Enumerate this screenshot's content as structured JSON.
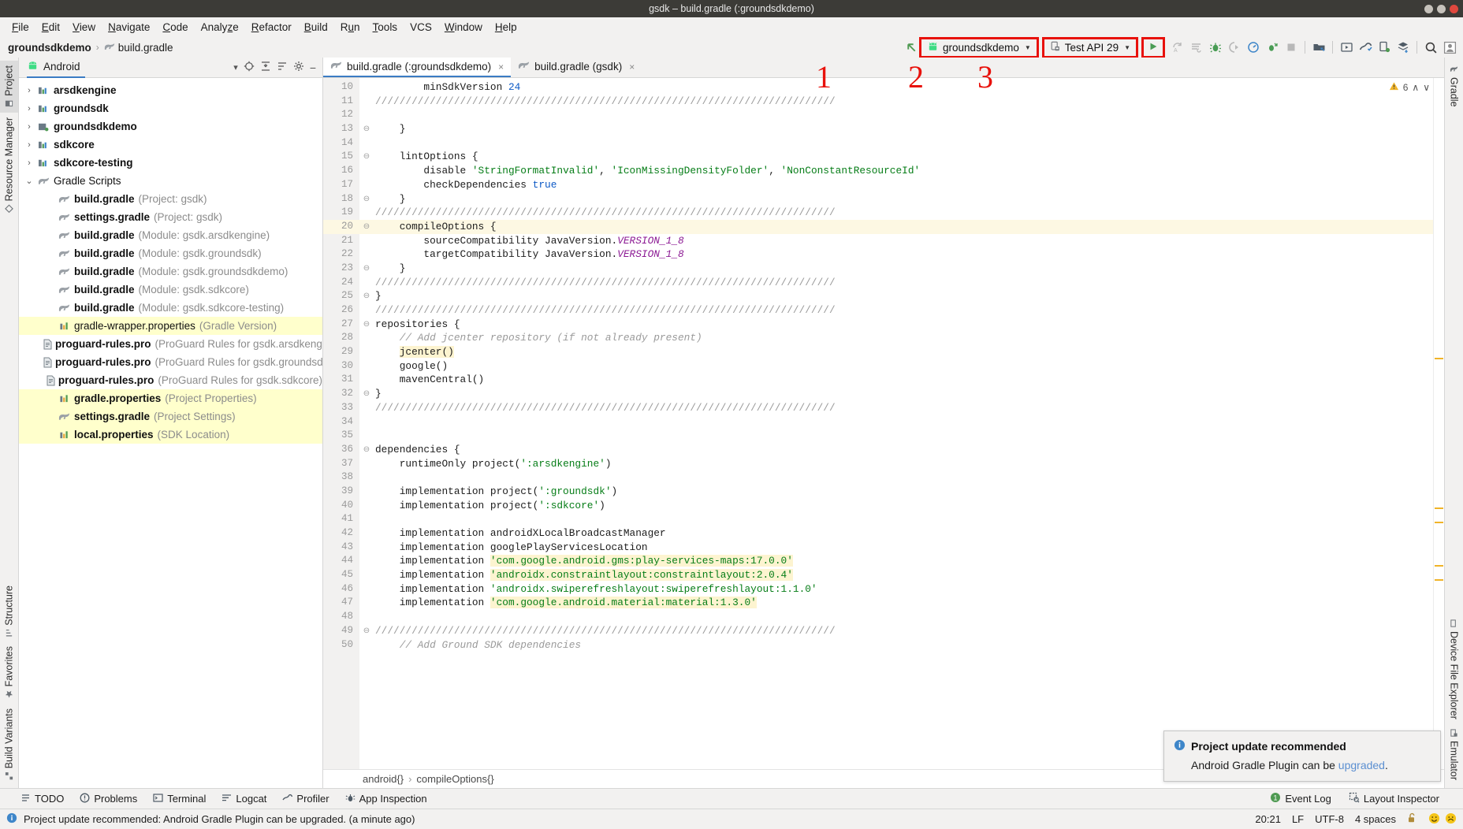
{
  "window": {
    "title": "gsdk – build.gradle (:groundsdkdemo)",
    "buttons": [
      "minimize",
      "maximize",
      "close"
    ]
  },
  "menubar": {
    "items": [
      {
        "label": "File",
        "mnemonic": "F"
      },
      {
        "label": "Edit",
        "mnemonic": "E"
      },
      {
        "label": "View",
        "mnemonic": "V"
      },
      {
        "label": "Navigate",
        "mnemonic": "N"
      },
      {
        "label": "Code",
        "mnemonic": "C"
      },
      {
        "label": "Analyze",
        "mnemonic": "z"
      },
      {
        "label": "Refactor",
        "mnemonic": "R"
      },
      {
        "label": "Build",
        "mnemonic": "B"
      },
      {
        "label": "Run",
        "mnemonic": "u"
      },
      {
        "label": "Tools",
        "mnemonic": "T"
      },
      {
        "label": "VCS",
        "mnemonic": ""
      },
      {
        "label": "Window",
        "mnemonic": "W"
      },
      {
        "label": "Help",
        "mnemonic": "H"
      }
    ]
  },
  "breadcrumb": {
    "project": "groundsdkdemo",
    "separator": "›",
    "file": "build.gradle"
  },
  "toolbar": {
    "module_selector": {
      "label": "groundsdkdemo",
      "icon": "android-robot-icon",
      "caret": "▼",
      "highlighted": true
    },
    "device_selector": {
      "label": "Test API 29",
      "icon": "device-icon",
      "caret": "▼",
      "highlighted": true
    },
    "run_button": {
      "label": "Run",
      "icon": "play-icon",
      "highlighted": true
    },
    "icons": [
      "apply-changes-icon",
      "apply-code-changes-icon",
      "debug-icon",
      "attach-debugger-icon",
      "profiler-icon",
      "run-with-coverage-icon",
      "stop-icon",
      "sdk-manager-icon",
      "avd-manager-icon",
      "device-monitor-icon",
      "device-file-explorer-icon",
      "layout-inspector-icon",
      "search-icon",
      "avatar-icon"
    ],
    "annotations": [
      {
        "number": "1",
        "target": "module_selector"
      },
      {
        "number": "2",
        "target": "device_selector"
      },
      {
        "number": "3",
        "target": "run_button"
      }
    ]
  },
  "left_rail": {
    "top_items": [
      {
        "label": "Project",
        "icon": "project-icon",
        "active": true
      },
      {
        "label": "Resource Manager",
        "icon": "resource-icon",
        "active": false
      }
    ],
    "bottom_items": [
      {
        "label": "Structure",
        "icon": "structure-icon"
      },
      {
        "label": "Favorites",
        "icon": "star-icon"
      },
      {
        "label": "Build Variants",
        "icon": "variants-icon"
      }
    ]
  },
  "right_rail": {
    "items": [
      {
        "label": "Gradle",
        "icon": "gradle-icon"
      },
      {
        "label": "Device File Explorer",
        "icon": "device-file-icon"
      },
      {
        "label": "Emulator",
        "icon": "emulator-icon"
      }
    ]
  },
  "project_panel": {
    "title": "Android",
    "title_icon": "android-robot-icon",
    "header_icons": [
      "chevron-down-icon",
      "target-icon",
      "collapse-all-icon",
      "settings-filter-icon",
      "gear-icon",
      "minimize-icon"
    ],
    "tree": [
      {
        "twist": "›",
        "icon": "module-icon",
        "label": "arsdkengine",
        "bold": true,
        "muted": "",
        "indent": 0,
        "highlight": false
      },
      {
        "twist": "›",
        "icon": "module-icon",
        "label": "groundsdk",
        "bold": true,
        "muted": "",
        "indent": 0,
        "highlight": false
      },
      {
        "twist": "›",
        "icon": "app-module-icon",
        "label": "groundsdkdemo",
        "bold": true,
        "muted": "",
        "indent": 0,
        "highlight": false
      },
      {
        "twist": "›",
        "icon": "module-icon",
        "label": "sdkcore",
        "bold": true,
        "muted": "",
        "indent": 0,
        "highlight": false
      },
      {
        "twist": "›",
        "icon": "module-icon",
        "label": "sdkcore-testing",
        "bold": true,
        "muted": "",
        "indent": 0,
        "highlight": false
      },
      {
        "twist": "⌄",
        "icon": "gradle-elephant-icon",
        "label": "Gradle Scripts",
        "bold": false,
        "muted": "",
        "indent": 0,
        "highlight": false
      },
      {
        "twist": "",
        "icon": "gradle-elephant-icon",
        "label": "build.gradle",
        "bold": true,
        "muted": "(Project: gsdk)",
        "indent": 1,
        "highlight": false
      },
      {
        "twist": "",
        "icon": "gradle-elephant-icon",
        "label": "settings.gradle",
        "bold": true,
        "muted": "(Project: gsdk)",
        "indent": 1,
        "highlight": false
      },
      {
        "twist": "",
        "icon": "gradle-elephant-icon",
        "label": "build.gradle",
        "bold": true,
        "muted": "(Module: gsdk.arsdkengine)",
        "indent": 1,
        "highlight": false
      },
      {
        "twist": "",
        "icon": "gradle-elephant-icon",
        "label": "build.gradle",
        "bold": true,
        "muted": "(Module: gsdk.groundsdk)",
        "indent": 1,
        "highlight": false
      },
      {
        "twist": "",
        "icon": "gradle-elephant-icon",
        "label": "build.gradle",
        "bold": true,
        "muted": "(Module: gsdk.groundsdkdemo)",
        "indent": 1,
        "highlight": false
      },
      {
        "twist": "",
        "icon": "gradle-elephant-icon",
        "label": "build.gradle",
        "bold": true,
        "muted": "(Module: gsdk.sdkcore)",
        "indent": 1,
        "highlight": false
      },
      {
        "twist": "",
        "icon": "gradle-elephant-icon",
        "label": "build.gradle",
        "bold": true,
        "muted": "(Module: gsdk.sdkcore-testing)",
        "indent": 1,
        "highlight": false
      },
      {
        "twist": "",
        "icon": "properties-icon",
        "label": "gradle-wrapper.properties",
        "bold": false,
        "muted": "(Gradle Version)",
        "indent": 1,
        "highlight": true
      },
      {
        "twist": "",
        "icon": "pro-file-icon",
        "label": "proguard-rules.pro",
        "bold": true,
        "muted": "(ProGuard Rules for gsdk.arsdkengine)",
        "indent": 1,
        "highlight": false
      },
      {
        "twist": "",
        "icon": "pro-file-icon",
        "label": "proguard-rules.pro",
        "bold": true,
        "muted": "(ProGuard Rules for gsdk.groundsdk)",
        "indent": 1,
        "highlight": false
      },
      {
        "twist": "",
        "icon": "pro-file-icon",
        "label": "proguard-rules.pro",
        "bold": true,
        "muted": "(ProGuard Rules for gsdk.sdkcore)",
        "indent": 1,
        "highlight": false
      },
      {
        "twist": "",
        "icon": "properties-icon",
        "label": "gradle.properties",
        "bold": true,
        "muted": "(Project Properties)",
        "indent": 1,
        "highlight": true
      },
      {
        "twist": "",
        "icon": "gradle-elephant-icon",
        "label": "settings.gradle",
        "bold": true,
        "muted": "(Project Settings)",
        "indent": 1,
        "highlight": true
      },
      {
        "twist": "",
        "icon": "properties-icon",
        "label": "local.properties",
        "bold": true,
        "muted": "(SDK Location)",
        "indent": 1,
        "highlight": true
      }
    ]
  },
  "editor": {
    "tabs": [
      {
        "label": "build.gradle (:groundsdkdemo)",
        "icon": "gradle-elephant-icon",
        "active": true,
        "close": "×"
      },
      {
        "label": "build.gradle (gsdk)",
        "icon": "gradle-elephant-icon",
        "active": false,
        "close": "×"
      }
    ],
    "inspection": {
      "warning_icon": "warning-triangle-icon",
      "warning_count": "6",
      "up": "∧",
      "down": "∨"
    },
    "first_line_number": 10,
    "lines": [
      {
        "n": 10,
        "fold": "",
        "hl": false,
        "tokens": [
          {
            "t": "        minSdkVersion ",
            "c": "k-plain"
          },
          {
            "t": "24",
            "c": "k-num"
          }
        ]
      },
      {
        "n": 11,
        "fold": "",
        "hl": false,
        "tokens": [
          {
            "t": "////////////////////////////////////////////////////////////////////////////",
            "c": "k-sl"
          }
        ]
      },
      {
        "n": 12,
        "fold": "",
        "hl": false,
        "tokens": [
          {
            "t": "",
            "c": "k-plain"
          }
        ]
      },
      {
        "n": 13,
        "fold": "⊖",
        "hl": false,
        "tokens": [
          {
            "t": "    }",
            "c": "k-plain"
          }
        ]
      },
      {
        "n": 14,
        "fold": "",
        "hl": false,
        "tokens": [
          {
            "t": "",
            "c": "k-plain"
          }
        ]
      },
      {
        "n": 15,
        "fold": "⊖",
        "hl": false,
        "tokens": [
          {
            "t": "    lintOptions {",
            "c": "k-plain"
          }
        ]
      },
      {
        "n": 16,
        "fold": "",
        "hl": false,
        "tokens": [
          {
            "t": "        disable ",
            "c": "k-plain"
          },
          {
            "t": "'StringFormatInvalid'",
            "c": "k-str"
          },
          {
            "t": ", ",
            "c": "k-plain"
          },
          {
            "t": "'IconMissingDensityFolder'",
            "c": "k-str"
          },
          {
            "t": ", ",
            "c": "k-plain"
          },
          {
            "t": "'NonConstantResourceId'",
            "c": "k-str"
          }
        ]
      },
      {
        "n": 17,
        "fold": "",
        "hl": false,
        "tokens": [
          {
            "t": "        checkDependencies ",
            "c": "k-plain"
          },
          {
            "t": "true",
            "c": "k-num"
          }
        ]
      },
      {
        "n": 18,
        "fold": "⊖",
        "hl": false,
        "tokens": [
          {
            "t": "    }",
            "c": "k-plain"
          }
        ]
      },
      {
        "n": 19,
        "fold": "",
        "hl": false,
        "tokens": [
          {
            "t": "////////////////////////////////////////////////////////////////////////////",
            "c": "k-sl"
          }
        ]
      },
      {
        "n": 20,
        "fold": "⊖",
        "hl": true,
        "tokens": [
          {
            "t": "    compileOptions {",
            "c": "k-plain"
          }
        ]
      },
      {
        "n": 21,
        "fold": "",
        "hl": false,
        "tokens": [
          {
            "t": "        sourceCompatibility JavaVersion.",
            "c": "k-plain"
          },
          {
            "t": "VERSION_1_8",
            "c": "k-static"
          }
        ]
      },
      {
        "n": 22,
        "fold": "",
        "hl": false,
        "tokens": [
          {
            "t": "        targetCompatibility JavaVersion.",
            "c": "k-plain"
          },
          {
            "t": "VERSION_1_8",
            "c": "k-static"
          }
        ]
      },
      {
        "n": 23,
        "fold": "⊖",
        "hl": false,
        "tokens": [
          {
            "t": "    }",
            "c": "k-plain"
          }
        ]
      },
      {
        "n": 24,
        "fold": "",
        "hl": false,
        "tokens": [
          {
            "t": "////////////////////////////////////////////////////////////////////////////",
            "c": "k-sl"
          }
        ]
      },
      {
        "n": 25,
        "fold": "⊖",
        "hl": false,
        "tokens": [
          {
            "t": "}",
            "c": "k-plain"
          }
        ]
      },
      {
        "n": 26,
        "fold": "",
        "hl": false,
        "tokens": [
          {
            "t": "////////////////////////////////////////////////////////////////////////////",
            "c": "k-sl"
          }
        ]
      },
      {
        "n": 27,
        "fold": "⊖",
        "hl": false,
        "tokens": [
          {
            "t": "repositories {",
            "c": "k-plain"
          }
        ]
      },
      {
        "n": 28,
        "fold": "",
        "hl": false,
        "tokens": [
          {
            "t": "    // Add jcenter repository (if not already present)",
            "c": "k-cmt"
          }
        ]
      },
      {
        "n": 29,
        "fold": "",
        "hl": false,
        "tokens": [
          {
            "t": "    ",
            "c": "k-plain"
          },
          {
            "t": "jcenter()",
            "c": "k-hlid"
          }
        ]
      },
      {
        "n": 30,
        "fold": "",
        "hl": false,
        "tokens": [
          {
            "t": "    google()",
            "c": "k-plain"
          }
        ]
      },
      {
        "n": 31,
        "fold": "",
        "hl": false,
        "tokens": [
          {
            "t": "    mavenCentral()",
            "c": "k-plain"
          }
        ]
      },
      {
        "n": 32,
        "fold": "⊖",
        "hl": false,
        "tokens": [
          {
            "t": "}",
            "c": "k-plain"
          }
        ]
      },
      {
        "n": 33,
        "fold": "",
        "hl": false,
        "tokens": [
          {
            "t": "////////////////////////////////////////////////////////////////////////////",
            "c": "k-sl"
          }
        ]
      },
      {
        "n": 34,
        "fold": "",
        "hl": false,
        "tokens": [
          {
            "t": "",
            "c": "k-plain"
          }
        ]
      },
      {
        "n": 35,
        "fold": "",
        "hl": false,
        "tokens": [
          {
            "t": "",
            "c": "k-plain"
          }
        ]
      },
      {
        "n": 36,
        "fold": "⊖",
        "hl": false,
        "tokens": [
          {
            "t": "dependencies {",
            "c": "k-plain"
          }
        ]
      },
      {
        "n": 37,
        "fold": "",
        "hl": false,
        "tokens": [
          {
            "t": "    runtimeOnly project(",
            "c": "k-plain"
          },
          {
            "t": "':arsdkengine'",
            "c": "k-str"
          },
          {
            "t": ")",
            "c": "k-plain"
          }
        ]
      },
      {
        "n": 38,
        "fold": "",
        "hl": false,
        "tokens": [
          {
            "t": "",
            "c": "k-plain"
          }
        ]
      },
      {
        "n": 39,
        "fold": "",
        "hl": false,
        "tokens": [
          {
            "t": "    implementation project(",
            "c": "k-plain"
          },
          {
            "t": "':groundsdk'",
            "c": "k-str"
          },
          {
            "t": ")",
            "c": "k-plain"
          }
        ]
      },
      {
        "n": 40,
        "fold": "",
        "hl": false,
        "tokens": [
          {
            "t": "    implementation project(",
            "c": "k-plain"
          },
          {
            "t": "':sdkcore'",
            "c": "k-str"
          },
          {
            "t": ")",
            "c": "k-plain"
          }
        ]
      },
      {
        "n": 41,
        "fold": "",
        "hl": false,
        "tokens": [
          {
            "t": "",
            "c": "k-plain"
          }
        ]
      },
      {
        "n": 42,
        "fold": "",
        "hl": false,
        "tokens": [
          {
            "t": "    implementation androidXLocalBroadcastManager",
            "c": "k-plain"
          }
        ]
      },
      {
        "n": 43,
        "fold": "",
        "hl": false,
        "tokens": [
          {
            "t": "    implementation googlePlayServicesLocation",
            "c": "k-plain"
          }
        ]
      },
      {
        "n": 44,
        "fold": "",
        "hl": false,
        "tokens": [
          {
            "t": "    implementation ",
            "c": "k-plain"
          },
          {
            "t": "'com.google.android.gms:play-services-maps:17.0.0'",
            "c": "k-hlstr"
          }
        ]
      },
      {
        "n": 45,
        "fold": "",
        "hl": false,
        "tokens": [
          {
            "t": "    implementation ",
            "c": "k-plain"
          },
          {
            "t": "'androidx.constraintlayout:constraintlayout:2.0.4'",
            "c": "k-hlstr"
          }
        ]
      },
      {
        "n": 46,
        "fold": "",
        "hl": false,
        "tokens": [
          {
            "t": "    implementation ",
            "c": "k-plain"
          },
          {
            "t": "'androidx.swiperefreshlayout:swiperefreshlayout:1.1.0'",
            "c": "k-str"
          }
        ]
      },
      {
        "n": 47,
        "fold": "",
        "hl": false,
        "tokens": [
          {
            "t": "    implementation ",
            "c": "k-plain"
          },
          {
            "t": "'com.google.android.material:material:1.3.0'",
            "c": "k-hlstr"
          }
        ]
      },
      {
        "n": 48,
        "fold": "",
        "hl": false,
        "tokens": [
          {
            "t": "",
            "c": "k-plain"
          }
        ]
      },
      {
        "n": 49,
        "fold": "⊖",
        "hl": false,
        "tokens": [
          {
            "t": "////////////////////////////////////////////////////////////////////////////",
            "c": "k-sl"
          }
        ]
      },
      {
        "n": 50,
        "fold": "",
        "hl": false,
        "tokens": [
          {
            "t": "    // Add Ground SDK dependencies",
            "c": "k-cmt"
          }
        ]
      }
    ],
    "footer_crumbs": [
      "android{}",
      "compileOptions{}"
    ],
    "footer_sep": "›"
  },
  "notification": {
    "icon": "info-icon",
    "title": "Project update recommended",
    "text_before": "Android Gradle Plugin can be ",
    "link": "upgraded",
    "text_after": "."
  },
  "bottom_bar": {
    "items": [
      {
        "label": "TODO",
        "icon": "todo-icon"
      },
      {
        "label": "Problems",
        "icon": "problems-icon"
      },
      {
        "label": "Terminal",
        "icon": "terminal-icon"
      },
      {
        "label": "Logcat",
        "icon": "logcat-icon"
      },
      {
        "label": "Profiler",
        "icon": "profiler-icon"
      },
      {
        "label": "App Inspection",
        "icon": "app-inspection-icon"
      }
    ],
    "right_items": [
      {
        "label": "Event Log",
        "icon": "event-log-icon",
        "badge": "1"
      },
      {
        "label": "Layout Inspector",
        "icon": "layout-inspector-icon"
      }
    ]
  },
  "status_bar": {
    "icon": "info-icon",
    "message": "Project update recommended: Android Gradle Plugin can be upgraded. (a minute ago)",
    "caret_position": "20:21",
    "line_separator": "LF",
    "encoding": "UTF-8",
    "indent": "4 spaces",
    "lock_icon": "unlocked-icon",
    "faces": [
      "happy-face-icon",
      "sad-face-icon"
    ]
  },
  "colors": {
    "accent": "#3b7cc4",
    "annotation_red": "#e8110b",
    "titlebar_bg": "#3c3b37",
    "panel_bg": "#f2f1f0",
    "string_green": "#067d17",
    "number_blue": "#0d5ac6",
    "highlight_yellow": "#ffffcc"
  }
}
